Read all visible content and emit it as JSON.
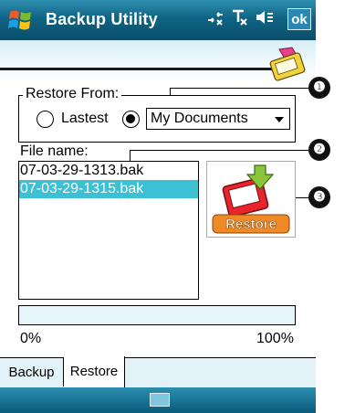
{
  "titlebar": {
    "title": "Backup Utility",
    "ok_label": "ok",
    "icons": [
      "windows-start-icon",
      "connectivity-icon",
      "signal-off-icon",
      "speaker-icon"
    ]
  },
  "restore_from": {
    "label": "Restore From:",
    "option_latest": "Lastest",
    "option_latest_selected": false,
    "location_selected": true,
    "location_value": "My Documents"
  },
  "files": {
    "label": "File name:",
    "items": [
      {
        "name": "07-03-29-1313.bak",
        "selected": false
      },
      {
        "name": "07-03-29-1315.bak",
        "selected": true
      }
    ]
  },
  "restore_button": {
    "label": "Restore"
  },
  "progress": {
    "value_percent": 0,
    "min_label": "0%",
    "max_label": "100%"
  },
  "tabs": [
    {
      "label": "Backup",
      "active": false
    },
    {
      "label": "Restore",
      "active": true
    }
  ],
  "callouts": [
    "❶",
    "❷",
    "❸"
  ],
  "colors": {
    "accent": "#3cc0d4",
    "titlebar": "#0f6383",
    "tab_bg": "#e3f2f8"
  }
}
